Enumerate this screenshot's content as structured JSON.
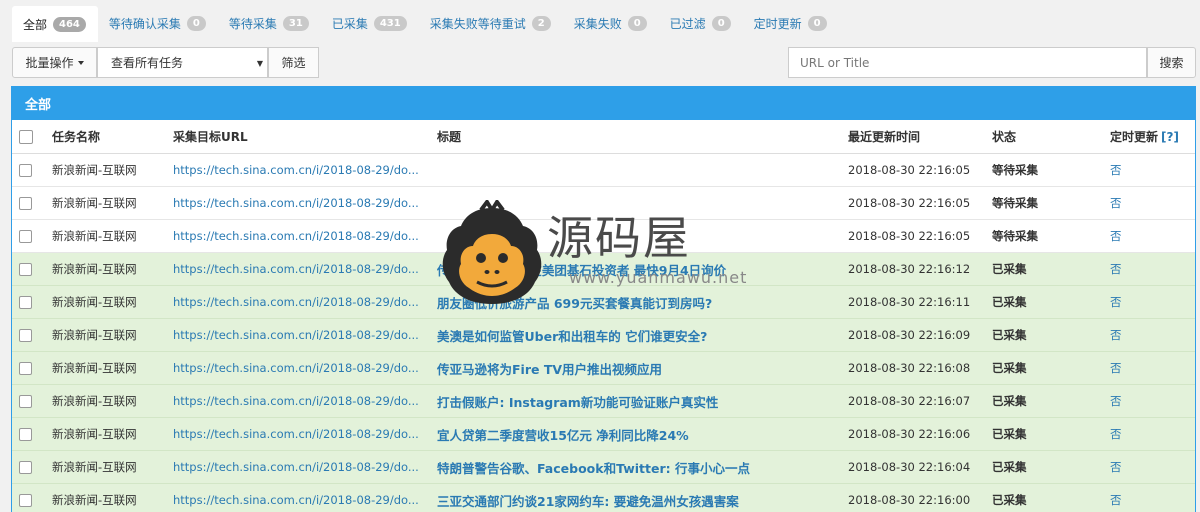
{
  "tabs": [
    {
      "label": "全部",
      "count": "464",
      "active": true
    },
    {
      "label": "等待确认采集",
      "count": "0"
    },
    {
      "label": "等待采集",
      "count": "31"
    },
    {
      "label": "已采集",
      "count": "431"
    },
    {
      "label": "采集失败等待重试",
      "count": "2"
    },
    {
      "label": "采集失败",
      "count": "0"
    },
    {
      "label": "已过滤",
      "count": "0"
    },
    {
      "label": "定时更新",
      "count": "0"
    }
  ],
  "toolbar": {
    "batch_label": "批量操作",
    "select_value": "查看所有任务",
    "filter_label": "筛选",
    "search_placeholder": "URL or Title",
    "search_label": "搜索"
  },
  "panel": {
    "title": "全部",
    "columns": {
      "name": "任务名称",
      "url": "采集目标URL",
      "title": "标题",
      "time": "最近更新时间",
      "status": "状态",
      "sched": "定时更新",
      "help": "[?]"
    }
  },
  "rows": [
    {
      "name": "新浪新闻-互联网",
      "url": "https://tech.sina.com.cn/i/2018-08-29/do...",
      "title": "",
      "time": "2018-08-30 22:16:05",
      "status": "等待采集",
      "sched": "否",
      "done": false
    },
    {
      "name": "新浪新闻-互联网",
      "url": "https://tech.sina.com.cn/i/2018-08-29/do...",
      "title": "",
      "time": "2018-08-30 22:16:05",
      "status": "等待采集",
      "sched": "否",
      "done": false
    },
    {
      "name": "新浪新闻-互联网",
      "url": "https://tech.sina.com.cn/i/2018-08-29/do...",
      "title": "",
      "time": "2018-08-30 22:16:05",
      "status": "等待采集",
      "sched": "否",
      "done": false
    },
    {
      "name": "新浪新闻-互联网",
      "url": "https://tech.sina.com.cn/i/2018-08-29/do...",
      "title": "传闻京东10亿元在美团基石投资者 最快9月4日询价",
      "time": "2018-08-30 22:16:12",
      "status": "已采集",
      "sched": "否",
      "done": true
    },
    {
      "name": "新浪新闻-互联网",
      "url": "https://tech.sina.com.cn/i/2018-08-29/do...",
      "title": "朋友圈低价旅游产品 699元买套餐真能订到房吗?",
      "time": "2018-08-30 22:16:11",
      "status": "已采集",
      "sched": "否",
      "done": true
    },
    {
      "name": "新浪新闻-互联网",
      "url": "https://tech.sina.com.cn/i/2018-08-29/do...",
      "title": "美澳是如何监管Uber和出租车的 它们谁更安全?",
      "time": "2018-08-30 22:16:09",
      "status": "已采集",
      "sched": "否",
      "done": true
    },
    {
      "name": "新浪新闻-互联网",
      "url": "https://tech.sina.com.cn/i/2018-08-29/do...",
      "title": "传亚马逊将为Fire TV用户推出视频应用",
      "time": "2018-08-30 22:16:08",
      "status": "已采集",
      "sched": "否",
      "done": true
    },
    {
      "name": "新浪新闻-互联网",
      "url": "https://tech.sina.com.cn/i/2018-08-29/do...",
      "title": "打击假账户: Instagram新功能可验证账户真实性",
      "time": "2018-08-30 22:16:07",
      "status": "已采集",
      "sched": "否",
      "done": true
    },
    {
      "name": "新浪新闻-互联网",
      "url": "https://tech.sina.com.cn/i/2018-08-29/do...",
      "title": "宜人贷第二季度营收15亿元 净利同比降24%",
      "time": "2018-08-30 22:16:06",
      "status": "已采集",
      "sched": "否",
      "done": true
    },
    {
      "name": "新浪新闻-互联网",
      "url": "https://tech.sina.com.cn/i/2018-08-29/do...",
      "title": "特朗普警告谷歌、Facebook和Twitter: 行事小心一点",
      "time": "2018-08-30 22:16:04",
      "status": "已采集",
      "sched": "否",
      "done": true
    },
    {
      "name": "新浪新闻-互联网",
      "url": "https://tech.sina.com.cn/i/2018-08-29/do...",
      "title": "三亚交通部门约谈21家网约车: 要避免温州女孩遇害案",
      "time": "2018-08-30 22:16:00",
      "status": "已采集",
      "sched": "否",
      "done": true
    }
  ],
  "watermark": {
    "brand": "源码屋",
    "url": "www.yuanmawu.net",
    "icon": "gorilla-icon"
  },
  "colors": {
    "accent": "#2e9fe8",
    "link": "#2a7ab3",
    "done_row": "#e3f2da"
  }
}
